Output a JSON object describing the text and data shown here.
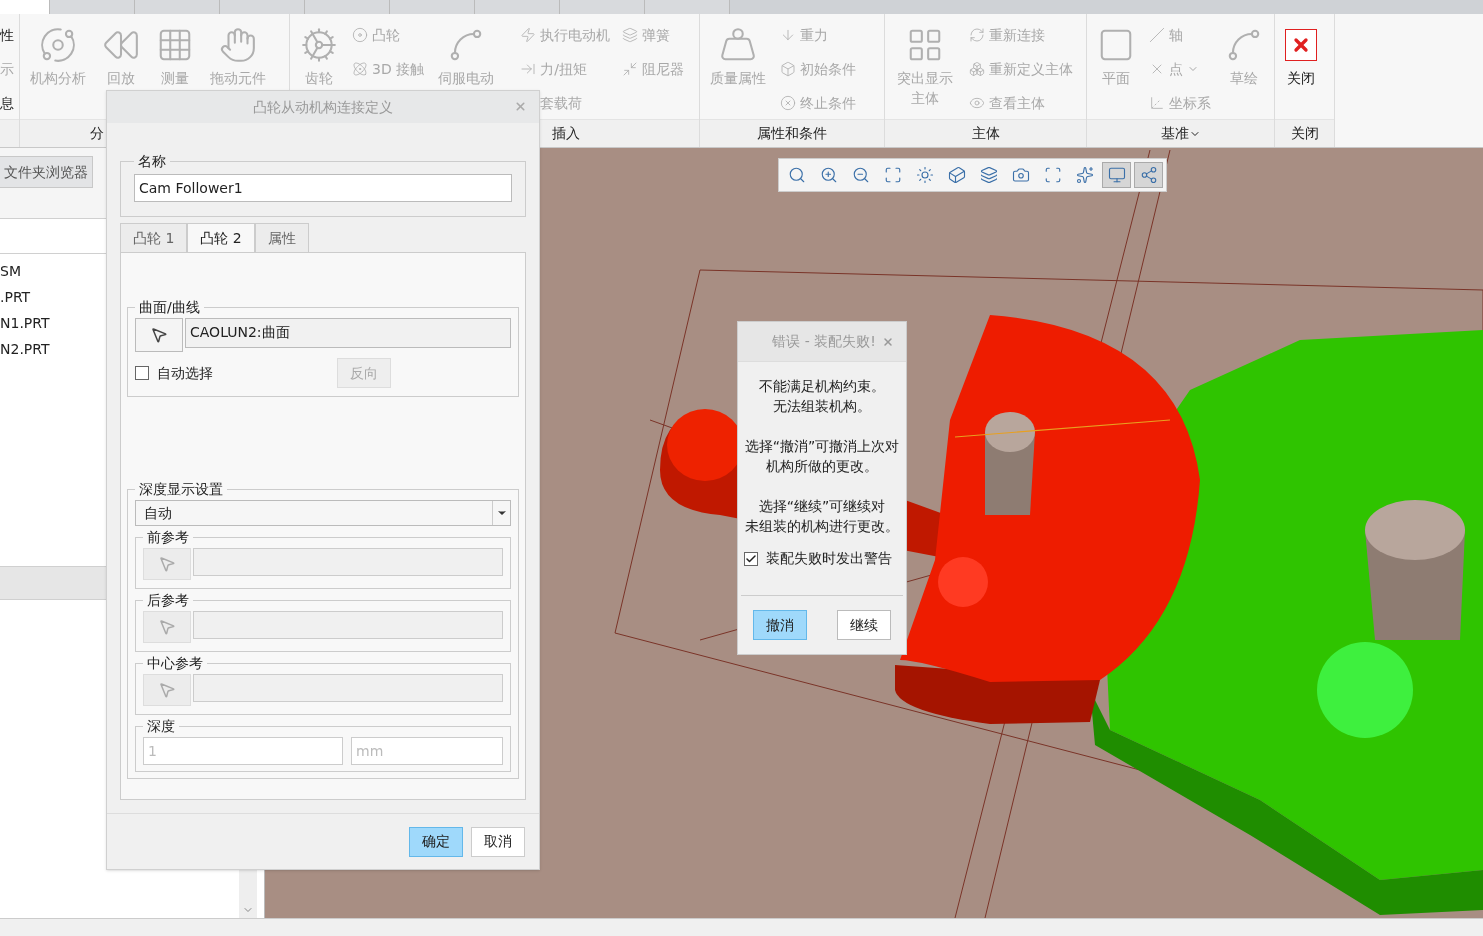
{
  "top_tabs": [
    {
      "selected": true
    },
    {
      "selected": false
    },
    {
      "selected": false
    },
    {
      "selected": false
    },
    {
      "selected": false
    },
    {
      "selected": false
    },
    {
      "selected": false
    },
    {
      "selected": false
    },
    {
      "selected": false
    }
  ],
  "ribbon": {
    "groups": [
      {
        "columns": [
          {
            "kind": "stack",
            "items": [
              {
                "label": "性",
                "disabled": false
              },
              {
                "label": "示",
                "disabled": true
              },
              {
                "label": "息",
                "disabled": false
              }
            ]
          }
        ]
      },
      {
        "label": "分",
        "columns": [
          {
            "kind": "large",
            "label": "机构分析",
            "disabled": true
          },
          {
            "kind": "large",
            "label": "回放",
            "disabled": true
          },
          {
            "kind": "large",
            "label": "测量",
            "disabled": true
          },
          {
            "kind": "large",
            "label": "拖动元件",
            "disabled": true
          }
        ]
      },
      {
        "label": "插入",
        "columns": [
          {
            "kind": "large",
            "label": "齿轮",
            "disabled": true
          },
          {
            "kind": "stack",
            "items": [
              {
                "label": "凸轮",
                "disabled": true
              },
              {
                "label": "3D 接触",
                "disabled": true
              }
            ]
          },
          {
            "kind": "large",
            "label": "伺服电动",
            "disabled": true
          },
          {
            "kind": "stack",
            "items": [
              {
                "label": "执行电动机",
                "disabled": true
              },
              {
                "label": "力/扭矩",
                "disabled": true
              },
              {
                "label": "套载荷",
                "disabled": true
              }
            ]
          },
          {
            "kind": "stack",
            "items": [
              {
                "label": "弹簧",
                "disabled": true
              },
              {
                "label": "阻尼器",
                "disabled": true
              }
            ]
          }
        ]
      },
      {
        "label": "属性和条件",
        "columns": [
          {
            "kind": "large",
            "label": "质量属性",
            "disabled": true
          },
          {
            "kind": "stack",
            "items": [
              {
                "label": "重力",
                "disabled": true
              },
              {
                "label": "初始条件",
                "disabled": true
              },
              {
                "label": "终止条件",
                "disabled": true
              }
            ]
          }
        ]
      },
      {
        "label": "主体",
        "columns": [
          {
            "kind": "large",
            "label": "突出显示主体",
            "disabled": true
          },
          {
            "kind": "stack",
            "items": [
              {
                "label": "重新连接",
                "disabled": true
              },
              {
                "label": "重新定义主体",
                "disabled": true
              },
              {
                "label": "查看主体",
                "disabled": true
              }
            ]
          }
        ]
      },
      {
        "label": "基准",
        "menu": true,
        "columns": [
          {
            "kind": "large",
            "label": "平面",
            "disabled": true
          },
          {
            "kind": "stack",
            "items": [
              {
                "label": "轴",
                "disabled": true
              },
              {
                "label": "点",
                "disabled": true,
                "menu": true
              },
              {
                "label": "坐标系",
                "disabled": true
              }
            ]
          },
          {
            "kind": "large",
            "label": "草绘",
            "disabled": true
          }
        ]
      },
      {
        "label": "关闭",
        "columns": [
          {
            "kind": "large",
            "label": "关闭",
            "disabled": false
          }
        ]
      }
    ]
  },
  "sidebar": {
    "tab": "文件夹浏览器",
    "items": [
      "SM",
      ".PRT",
      "N1.PRT",
      "N2.PRT"
    ]
  },
  "view_toolbar": [
    {
      "selected": false
    },
    {
      "selected": false
    },
    {
      "selected": false
    },
    {
      "selected": false
    },
    {
      "selected": false
    },
    {
      "selected": false
    },
    {
      "selected": false
    },
    {
      "selected": false
    },
    {
      "selected": false
    },
    {
      "selected": false
    },
    {
      "selected": true
    },
    {
      "selected": true
    }
  ],
  "dialog": {
    "title": "凸轮从动机构连接定义",
    "name_label": "名称",
    "name_value": "Cam Follower1",
    "tabs": [
      {
        "label": "凸轮 1",
        "selected": false
      },
      {
        "label": "凸轮 2",
        "selected": true
      },
      {
        "label": "属性",
        "selected": false
      }
    ],
    "surface": {
      "label": "曲面/曲线",
      "value": "CAOLUN2:曲面",
      "auto_select": {
        "label": "自动选择",
        "checked": false
      },
      "reverse": {
        "label": "反向",
        "disabled": true
      }
    },
    "depth": {
      "label": "深度显示设置",
      "option": "自动",
      "refs": [
        {
          "label": "前参考"
        },
        {
          "label": "后参考"
        },
        {
          "label": "中心参考"
        }
      ],
      "depth_label": "深度",
      "depth_placeholder": "1",
      "unit_placeholder": "mm"
    },
    "buttons": [
      {
        "label": "确定",
        "selected": true
      },
      {
        "label": "取消",
        "selected": false
      }
    ]
  },
  "error_dialog": {
    "title": "错误 - 装配失败!",
    "messages": [
      [
        "不能满足机构约束。",
        "无法组装机构。"
      ],
      [
        "选择“撤消”可撤消上次对",
        "机构所做的更改。"
      ],
      [
        "选择“继续”可继续对",
        "未组装的机构进行更改。"
      ]
    ],
    "warn": {
      "label": "装配失败时发出警告",
      "checked": true
    },
    "buttons": [
      {
        "label": "撤消",
        "selected": true
      },
      {
        "label": "继续",
        "selected": false
      }
    ]
  }
}
